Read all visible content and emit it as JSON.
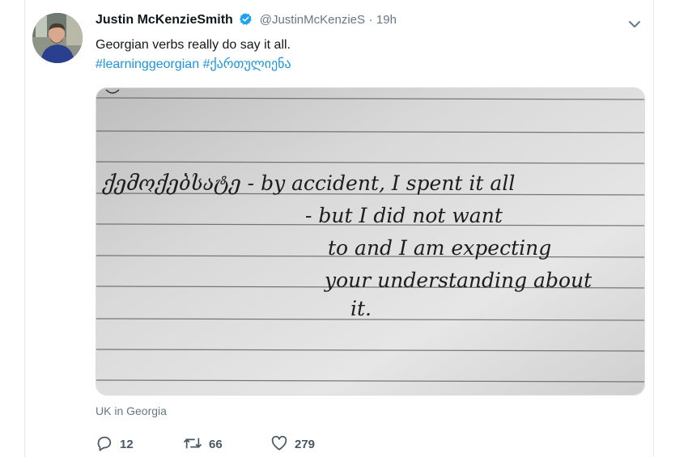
{
  "tweet": {
    "author_name": "Justin McKenzieSmith",
    "handle": "@JustinMcKenzieS",
    "separator": "·",
    "time": "19h",
    "text": "Georgian verbs really do say it all.",
    "hashtags": [
      "#learninggeorgian",
      "#ქართულიენა"
    ],
    "location": "UK in Georgia",
    "verified": true
  },
  "media": {
    "handwriting_lines": [
      "ქემოქებსატე  -  by accident, I spent it all",
      "- but I did not want",
      "to and I am expecting",
      "your understanding about",
      "it."
    ]
  },
  "actions": {
    "reply_count": "12",
    "retweet_count": "66",
    "like_count": "279"
  },
  "colors": {
    "link": "#1b95e0",
    "verified": "#1da1f2",
    "muted": "#657786"
  },
  "icons": [
    "verified-badge-icon",
    "chevron-down-icon",
    "reply-icon",
    "retweet-icon",
    "like-icon"
  ]
}
